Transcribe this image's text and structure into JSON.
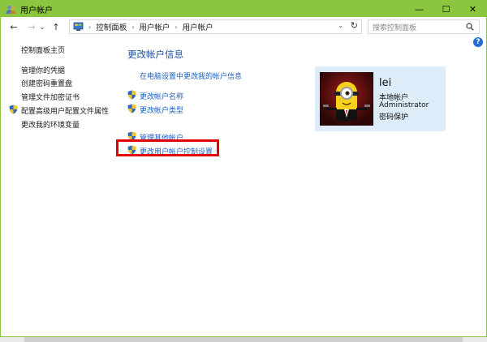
{
  "window": {
    "title": "用户帐户",
    "controls": {
      "minimize": "—",
      "maximize": "☐",
      "close": "✕"
    }
  },
  "navbar": {
    "back": "←",
    "forward": "→",
    "recent": "⌄",
    "up": "↑",
    "breadcrumb": [
      "控制面板",
      "用户帐户",
      "用户帐户"
    ],
    "dropdown": "⌄",
    "refresh": "↻",
    "search_placeholder": "搜索控制面板"
  },
  "help": {
    "label": "?"
  },
  "left_nav": {
    "home": "控制面板主页",
    "items": [
      {
        "label": "管理你的凭据",
        "shield": false
      },
      {
        "label": "创建密码重置盘",
        "shield": false
      },
      {
        "label": "管理文件加密证书",
        "shield": false
      },
      {
        "label": "配置高级用户配置文件属性",
        "shield": true
      },
      {
        "label": "更改我的环境变量",
        "shield": false
      }
    ]
  },
  "main": {
    "title": "更改帐户信息",
    "pc_settings_link": "在电脑设置中更改我的帐户信息",
    "change_name": "更改帐户名称",
    "change_type": "更改帐户类型",
    "manage_other": "管理其他帐户",
    "uac_settings": "更改用户帐户控制设置"
  },
  "account": {
    "name": "lei",
    "type": "本地帐户",
    "role": "Administrator",
    "password": "密码保护"
  },
  "colors": {
    "titlebar": "#8cc63f",
    "link": "#1c5fbd",
    "heading": "#1e4ea0",
    "card": "#dcecf8",
    "highlight": "#e30000"
  }
}
